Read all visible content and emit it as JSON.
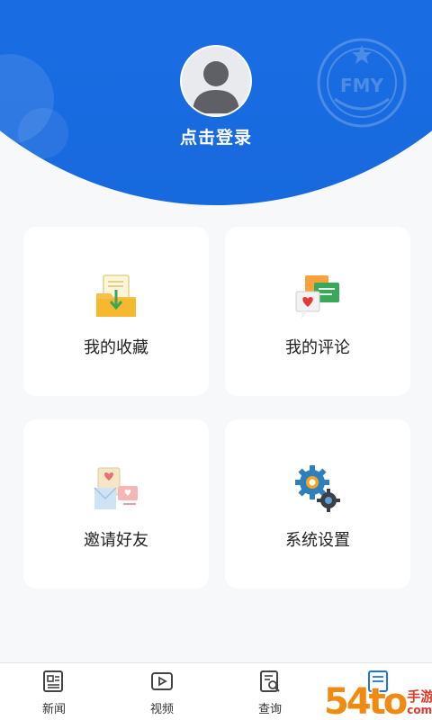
{
  "profile": {
    "login_label": "点击登录",
    "emblem_text": "FMY"
  },
  "menu": {
    "items": [
      {
        "label": "我的收藏",
        "icon": "folder-download-icon"
      },
      {
        "label": "我的评论",
        "icon": "chat-bubbles-icon"
      },
      {
        "label": "邀请好友",
        "icon": "invite-envelope-icon"
      },
      {
        "label": "系统设置",
        "icon": "gears-icon"
      }
    ]
  },
  "tabbar": {
    "tabs": [
      {
        "label": "新闻",
        "icon": "news-icon"
      },
      {
        "label": "视频",
        "icon": "video-icon"
      },
      {
        "label": "查询",
        "icon": "search-document-icon"
      },
      {
        "label": "",
        "icon": "profile-document-icon"
      }
    ]
  },
  "watermark": {
    "big": "54to",
    "cn": "手游网",
    "url": "com.cn"
  },
  "colors": {
    "header_blue": "#1e73e8",
    "tab_active": "#1e73e8",
    "watermark_orange": "#f08a10"
  }
}
